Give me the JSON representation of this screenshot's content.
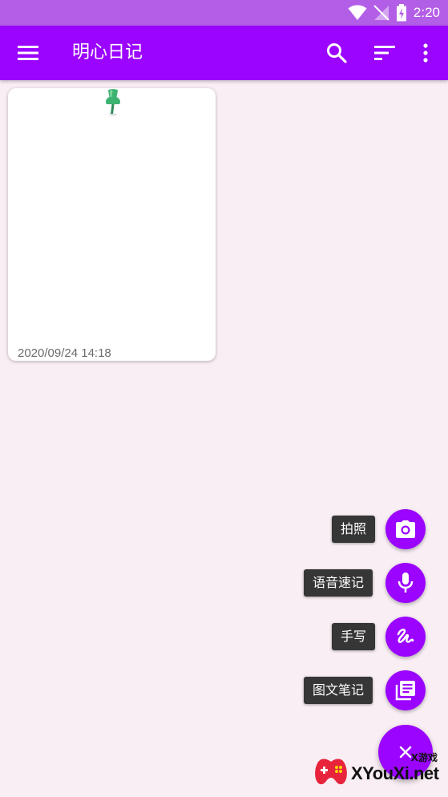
{
  "status_bar": {
    "time": "2:20",
    "icons": [
      "wifi-icon",
      "signal-icon",
      "battery-icon"
    ]
  },
  "app_bar": {
    "title": "明心日记",
    "icons": [
      "menu-icon",
      "search-icon",
      "sort-icon",
      "more-vert-icon"
    ]
  },
  "notes": [
    {
      "date": "2020/09/24 14:18",
      "icon": "pin-icon"
    }
  ],
  "fab_menu": {
    "items": [
      {
        "label": "拍照",
        "icon": "camera-icon"
      },
      {
        "label": "语音速记",
        "icon": "mic-icon"
      },
      {
        "label": "手写",
        "icon": "handwriting-icon"
      },
      {
        "label": "图文笔记",
        "icon": "library-books-icon"
      }
    ],
    "main_icon": "close-icon"
  },
  "watermark": {
    "small_text": "X游戏",
    "text": "XYouXi.net"
  },
  "colors": {
    "primary": "#9b04ff",
    "status_bar": "#b35ee6",
    "background": "#f8eef4",
    "card": "#ffffff",
    "label_bg": "#363636",
    "pin": "#3cb371"
  }
}
